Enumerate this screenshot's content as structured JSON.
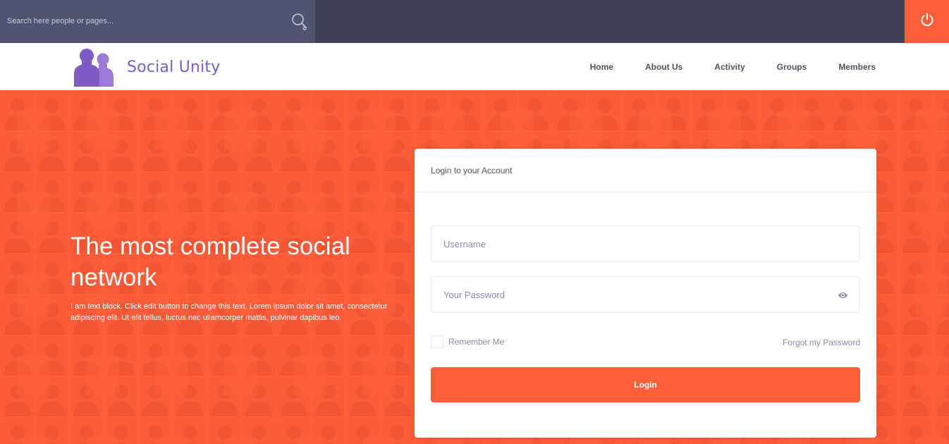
{
  "search": {
    "placeholder": "Search here people or pages..."
  },
  "topbar": {
    "power_icon": "power-icon"
  },
  "brand": {
    "name": "Social Unity",
    "color": "#7e5bc5",
    "icon": "users-icon"
  },
  "nav": {
    "items": [
      "Home",
      "About Us",
      "Activity",
      "Groups",
      "Members"
    ]
  },
  "hero": {
    "title": "The most complete social network",
    "text": "I am text block. Click edit button to change this text. Lorem ipsum dolor sit amet, consectetur adipiscing elit. Ut elit tellus, luctus nec ullamcorper mattis, pulvinar dapibus leo.",
    "background_color": "#ff5e3a"
  },
  "login": {
    "title": "Login to your Account",
    "username_placeholder": "Username",
    "password_placeholder": "Your Password",
    "remember_label": "Remember Me",
    "forgot_label": "Forgot my Password",
    "submit_label": "Login"
  },
  "colors": {
    "accent": "#ff5e3a",
    "topbar": "#3f4257",
    "search_bg": "#515470",
    "text": "#515365",
    "muted": "#888da8"
  }
}
